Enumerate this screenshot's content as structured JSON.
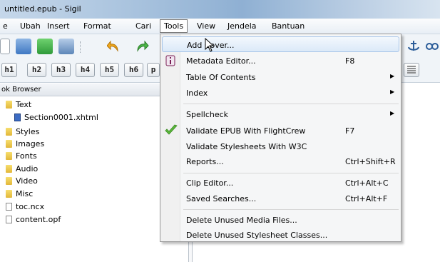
{
  "window": {
    "title": "untitled.epub - Sigil"
  },
  "menubar": {
    "items": [
      "e",
      "Ubah",
      "Insert",
      "Format",
      "Cari",
      "Tools",
      "View",
      "Jendela",
      "Bantuan"
    ]
  },
  "toolbar": {
    "heading_buttons": [
      "h1",
      "h2",
      "h3",
      "h4",
      "h5",
      "h6",
      "p"
    ]
  },
  "book_browser": {
    "header": "ok Browser",
    "tree": [
      {
        "label": "Text",
        "type": "folder",
        "depth": 0
      },
      {
        "label": "Section0001.xhtml",
        "type": "xhtml",
        "depth": 1
      },
      {
        "label": "Styles",
        "type": "folder",
        "depth": 0
      },
      {
        "label": "Images",
        "type": "folder",
        "depth": 0
      },
      {
        "label": "Fonts",
        "type": "folder",
        "depth": 0
      },
      {
        "label": "Audio",
        "type": "folder",
        "depth": 0
      },
      {
        "label": "Video",
        "type": "folder",
        "depth": 0
      },
      {
        "label": "Misc",
        "type": "folder",
        "depth": 0
      },
      {
        "label": "toc.ncx",
        "type": "file",
        "depth": 0
      },
      {
        "label": "content.opf",
        "type": "file",
        "depth": 0
      }
    ]
  },
  "tools_menu": {
    "items": [
      {
        "label": "Add Cover...",
        "shortcut": "",
        "highlighted": true
      },
      {
        "label": "Metadata Editor...",
        "shortcut": "F8",
        "icon": "info-icon"
      },
      {
        "label": "Table Of Contents",
        "shortcut": "",
        "submenu": true
      },
      {
        "label": "Index",
        "shortcut": "",
        "submenu": true
      },
      {
        "label": "Spellcheck",
        "shortcut": "",
        "submenu": true
      },
      {
        "label": "Validate EPUB With FlightCrew",
        "shortcut": "F7",
        "icon": "checkmark-icon"
      },
      {
        "label": "Validate Stylesheets With W3C",
        "shortcut": ""
      },
      {
        "label": "Reports...",
        "shortcut": "Ctrl+Shift+R"
      },
      {
        "label": "Clip Editor...",
        "shortcut": "Ctrl+Alt+C"
      },
      {
        "label": "Saved Searches...",
        "shortcut": "Ctrl+Alt+F"
      },
      {
        "label": "Delete Unused Media Files...",
        "shortcut": ""
      },
      {
        "label": "Delete Unused Stylesheet Classes...",
        "shortcut": ""
      }
    ],
    "submenu_arrow": "▶"
  }
}
